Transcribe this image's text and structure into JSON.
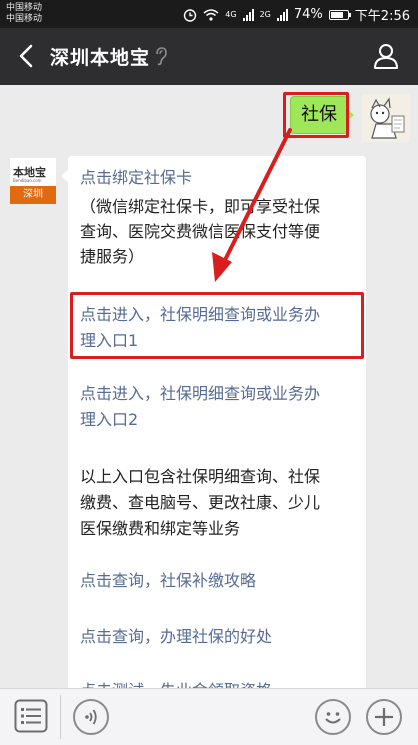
{
  "status_bar": {
    "carrier_1": "中国移动",
    "carrier_2": "中国移动",
    "net_1": "4G",
    "net_2": "2G",
    "battery": "74%",
    "battery_level": 0.74,
    "time": "下午2:56"
  },
  "title_bar": {
    "title": "深圳本地宝"
  },
  "chat": {
    "outgoing_text": "社保",
    "brand_logo": {
      "top_text": "本地宝",
      "url": "Bendibao.com",
      "bottom_text": "深圳"
    },
    "reply_lines": [
      {
        "text": "点击绑定社保卡",
        "style": "link"
      },
      {
        "text": "（微信绑定社保卡，即可享受社保",
        "style": "dark"
      },
      {
        "text": "查询、医院交费微信医保支付等便",
        "style": "dark"
      },
      {
        "text": "捷服务）",
        "style": "dark"
      },
      {
        "text": "点击进入，社保明细查询或业务办",
        "style": "link"
      },
      {
        "text": "理入口1",
        "style": "link"
      },
      {
        "text": "点击进入，社保明细查询或业务办",
        "style": "link"
      },
      {
        "text": "理入口2",
        "style": "link"
      },
      {
        "text": "以上入口包含社保明细查询、社保",
        "style": "dark"
      },
      {
        "text": "缴费、查电脑号、更改社康、少儿",
        "style": "dark"
      },
      {
        "text": "医保缴费和绑定等业务",
        "style": "dark"
      },
      {
        "text": "点击查询，社保补缴攻略",
        "style": "link"
      },
      {
        "text": "点击查询，办理社保的好处",
        "style": "link"
      },
      {
        "text": "点击测试，失业金领取资格",
        "style": "link"
      }
    ]
  },
  "colors": {
    "highlight": "#d91e1e",
    "link": "#576b95",
    "bubble_green": "#9fe658",
    "titlebar": "#2e2e31"
  },
  "icons": [
    "back-arrow-icon",
    "earpiece-icon",
    "person-icon",
    "menu-list-icon",
    "voice-icon",
    "emoji-icon",
    "plus-icon"
  ]
}
